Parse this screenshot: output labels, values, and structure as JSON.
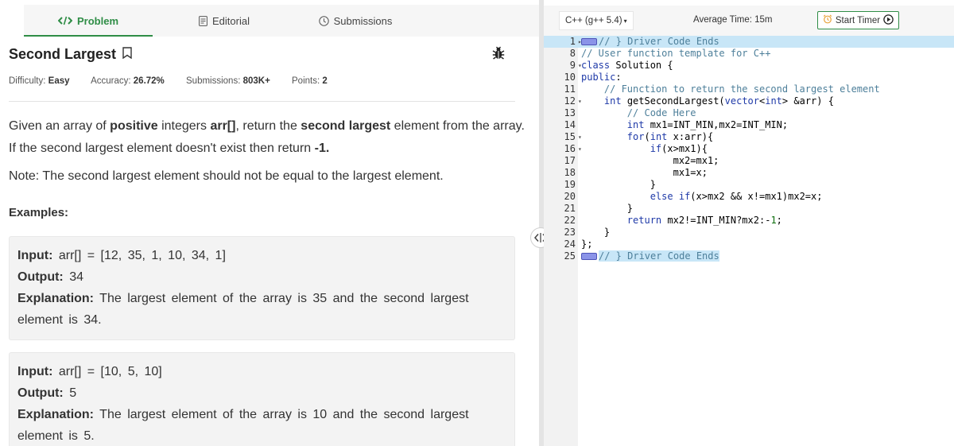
{
  "tabs": [
    {
      "label": "Problem",
      "icon": "code-icon"
    },
    {
      "label": "Editorial",
      "icon": "document-icon"
    },
    {
      "label": "Submissions",
      "icon": "clock-icon"
    }
  ],
  "problem": {
    "title": "Second Largest",
    "difficulty_label": "Difficulty:",
    "difficulty": "Easy",
    "accuracy_label": "Accuracy:",
    "accuracy": "26.72%",
    "submissions_label": "Submissions:",
    "submissions": "803K+",
    "points_label": "Points:",
    "points": "2",
    "desc_1": "Given an array of ",
    "desc_bold_1": "positive",
    "desc_2": " integers ",
    "desc_bold_2": "arr[]",
    "desc_3": ", return the ",
    "desc_bold_3": "second largest",
    "desc_4": " element from the array. If the second largest element doesn't exist then return ",
    "desc_bold_4": "-1.",
    "note": "Note: The second largest element should not be equal to the largest element.",
    "examples_heading": "Examples:",
    "examples": [
      {
        "input_label": "Input:",
        "input": "arr[] = [12, 35, 1, 10, 34, 1]",
        "output_label": "Output:",
        "output": "34",
        "explanation_label": "Explanation:",
        "explanation": "The largest element of the array is 35 and the second largest element is 34."
      },
      {
        "input_label": "Input:",
        "input": "arr[] = [10, 5, 10]",
        "output_label": "Output:",
        "output": "5",
        "explanation_label": "Explanation:",
        "explanation": "The largest element of the array is 10 and the second largest element is 5."
      }
    ]
  },
  "editor": {
    "language": "C++ (g++ 5.4)",
    "average_time": "Average Time: 15m",
    "timer_label": "Start Timer",
    "lines": [
      {
        "num": "1",
        "fold": "▸",
        "code": "// } Driver Code Ends",
        "hl": true,
        "marker": true
      },
      {
        "num": "8",
        "fold": "",
        "code": "// User function template for C++",
        "hl": false
      },
      {
        "num": "9",
        "fold": "▾",
        "code": "class Solution {",
        "hl": false
      },
      {
        "num": "10",
        "fold": "",
        "code": "public:",
        "hl": false
      },
      {
        "num": "11",
        "fold": "",
        "code": "    // Function to return the second largest element",
        "hl": false
      },
      {
        "num": "12",
        "fold": "▾",
        "code": "    int getSecondLargest(vector<int> &arr) {",
        "hl": false
      },
      {
        "num": "13",
        "fold": "",
        "code": "        // Code Here",
        "hl": false
      },
      {
        "num": "14",
        "fold": "",
        "code": "        int mx1=INT_MIN,mx2=INT_MIN;",
        "hl": false
      },
      {
        "num": "15",
        "fold": "▾",
        "code": "        for(int x:arr){",
        "hl": false
      },
      {
        "num": "16",
        "fold": "▾",
        "code": "            if(x>mx1){",
        "hl": false
      },
      {
        "num": "17",
        "fold": "",
        "code": "                mx2=mx1;",
        "hl": false
      },
      {
        "num": "18",
        "fold": "",
        "code": "                mx1=x;",
        "hl": false
      },
      {
        "num": "19",
        "fold": "",
        "code": "            }",
        "hl": false
      },
      {
        "num": "20",
        "fold": "",
        "code": "            else if(x>mx2 && x!=mx1)mx2=x;",
        "hl": false
      },
      {
        "num": "21",
        "fold": "",
        "code": "        }",
        "hl": false
      },
      {
        "num": "22",
        "fold": "",
        "code": "        return mx2!=INT_MIN?mx2:-1;",
        "hl": false
      },
      {
        "num": "23",
        "fold": "",
        "code": "    }",
        "hl": false
      },
      {
        "num": "24",
        "fold": "",
        "code": "};",
        "hl": false
      },
      {
        "num": "25",
        "fold": "",
        "code": "// } Driver Code Ends",
        "hl": false,
        "marker": true
      }
    ]
  },
  "colors": {
    "accent": "#2f8d46",
    "line_highlight": "#c8e6f7",
    "comment": "#4d7f9a",
    "keyword": "#1f3aa8"
  }
}
